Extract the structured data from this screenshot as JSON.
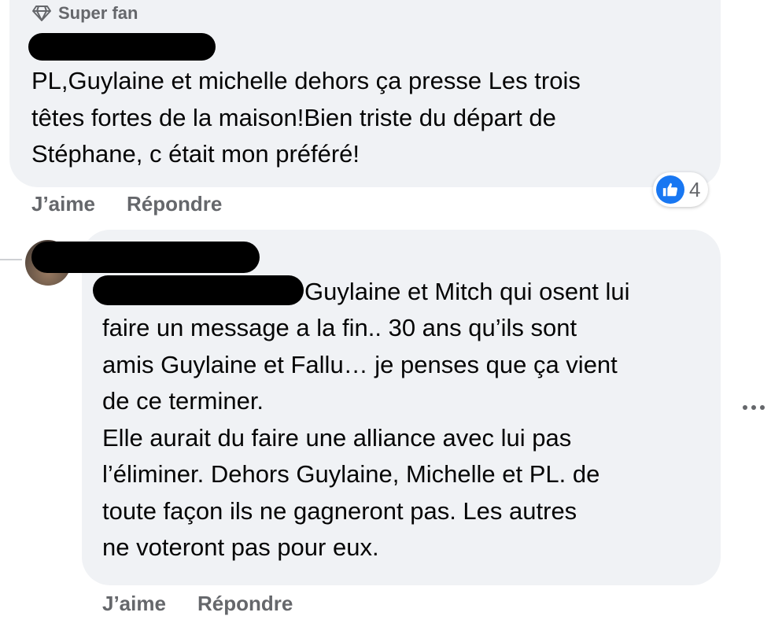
{
  "comment1": {
    "badge_label": "Super fan",
    "badge_icon": "diamond-icon",
    "text": "PL,Guylaine et michelle dehors ça presse Les trois\ntêtes fortes de la maison!Bien triste du départ de\nStéphane, c était mon préféré!",
    "like_label": "J’aime",
    "reply_label": "Répondre",
    "reaction_count": "4",
    "reaction_icon": "thumbs-up-icon"
  },
  "comment2": {
    "text_first_line": "Guylaine et Mitch qui osent lui",
    "text": "faire un message a la fin.. 30 ans qu’ils sont\namis Guylaine et Fallu… je penses que ça vient\nde ce terminer.\nElle aurait du faire une alliance avec lui pas\nl’éliminer. Dehors Guylaine, Michelle et PL. de\ntoute façon ils ne gagneront pas. Les autres\nne voteront pas pour eux.",
    "like_label": "J’aime",
    "reply_label": "Répondre",
    "more_icon": "more-options-icon"
  },
  "colors": {
    "bubble": "#f0f2f5",
    "secondary_text": "#65676b",
    "like_blue": "#1877f2"
  }
}
